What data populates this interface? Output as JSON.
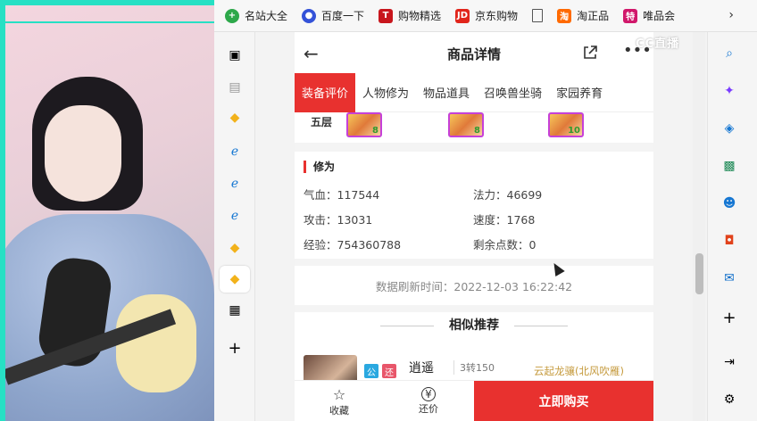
{
  "bookmarks": [
    {
      "label": "名站大全",
      "icon": "plus-circle-icon",
      "color": "#2da84a"
    },
    {
      "label": "百度一下",
      "icon": "baidu-paw-icon",
      "color": "#3452d8"
    },
    {
      "label": "购物精选",
      "icon": "t-icon",
      "color": "#c8161d"
    },
    {
      "label": "京东购物",
      "icon": "jd-icon",
      "color": "#e1251b"
    },
    {
      "label": "淘正品",
      "icon": "tao-icon",
      "color": "#ff6a00"
    },
    {
      "label": "唯品会",
      "icon": "te-icon",
      "color": "#d1186b"
    }
  ],
  "header": {
    "title": "商品详情"
  },
  "tabs": [
    "装备评价",
    "人物修为",
    "物品道具",
    "召唤兽坐骑",
    "家园养育"
  ],
  "equipment": {
    "floor_label": "五层",
    "gems": [
      "8",
      "8",
      "10"
    ]
  },
  "cultivation": {
    "title": "修为",
    "hp": "气血：117544",
    "mp": "法力：46699",
    "attack": "攻击：13031",
    "speed": "速度：1768",
    "exp": "经验：754360788",
    "points": "剩余点数：0"
  },
  "refresh_time": "数据刷新时间：2022-12-03 16:22:42",
  "similar": {
    "title": "相似推荐",
    "item": {
      "tag1": "公",
      "tag2": "还",
      "name": "逍遥",
      "meta": "3转150",
      "mount": "云起龙骧(北风吹雁)"
    }
  },
  "bottom": {
    "favorite": "收藏",
    "bargain": "还价",
    "buy": "立即购买"
  },
  "watermark": "CC直播",
  "colors": {
    "accent": "#e8312f",
    "gem_border": "#c640d8"
  }
}
